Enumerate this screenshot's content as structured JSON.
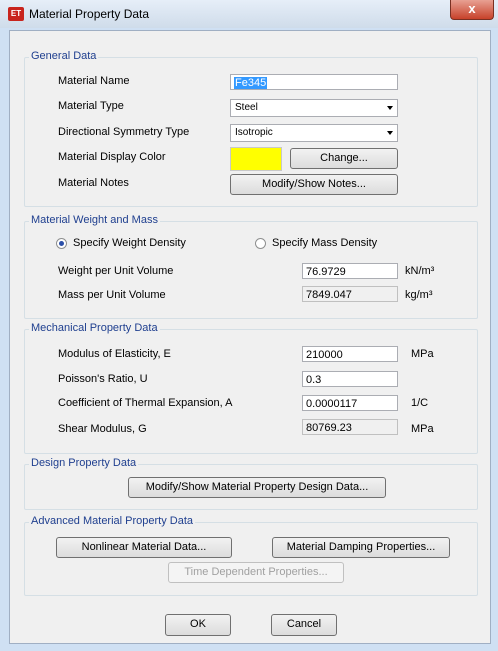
{
  "window": {
    "title": "Material Property Data",
    "icon_text": "ET",
    "close_label": "x"
  },
  "general": {
    "title": "General Data",
    "material_name_label": "Material Name",
    "material_name_value": "Fe345",
    "material_type_label": "Material Type",
    "material_type_value": "Steel",
    "symmetry_label": "Directional Symmetry Type",
    "symmetry_value": "Isotropic",
    "color_label": "Material Display Color",
    "color_value": "#ffff00",
    "change_button": "Change...",
    "notes_label": "Material Notes",
    "notes_button": "Modify/Show Notes..."
  },
  "weight": {
    "title": "Material Weight and Mass",
    "radio_weight": "Specify Weight Density",
    "radio_mass": "Specify Mass Density",
    "selected": "weight",
    "weight_label": "Weight per Unit Volume",
    "weight_value": "76.9729",
    "weight_unit": "kN/m³",
    "mass_label": "Mass per Unit Volume",
    "mass_value": "7849.047",
    "mass_unit": "kg/m³"
  },
  "mechanical": {
    "title": "Mechanical Property Data",
    "e_label": "Modulus of Elasticity,  E",
    "e_value": "210000",
    "e_unit": "MPa",
    "u_label": "Poisson's Ratio,  U",
    "u_value": "0.3",
    "a_label": "Coefficient of Thermal Expansion,  A",
    "a_value": "0.0000117",
    "a_unit": "1/C",
    "g_label": "Shear Modulus,  G",
    "g_value": "80769.23",
    "g_unit": "MPa"
  },
  "design": {
    "title": "Design Property Data",
    "button": "Modify/Show Material Property Design Data..."
  },
  "advanced": {
    "title": "Advanced Material Property Data",
    "nonlinear_button": "Nonlinear Material Data...",
    "damping_button": "Material Damping Properties...",
    "time_button": "Time Dependent Properties..."
  },
  "footer": {
    "ok": "OK",
    "cancel": "Cancel"
  }
}
